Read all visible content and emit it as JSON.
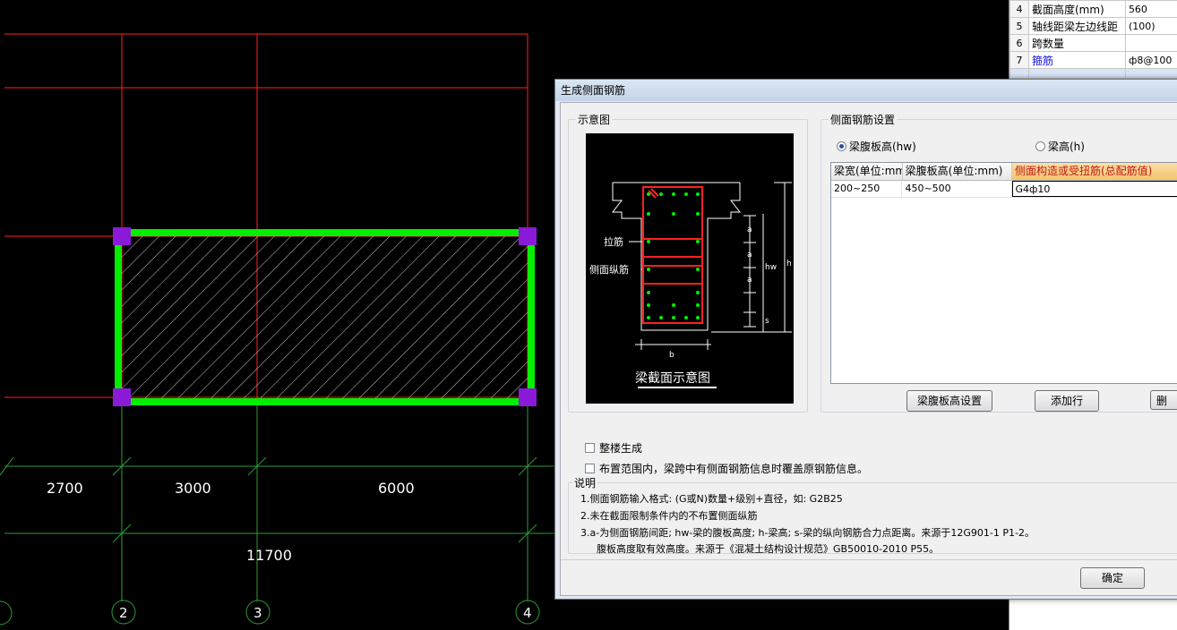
{
  "cad": {
    "dimensions": [
      "2700",
      "3000",
      "6000"
    ],
    "total_dimension": "11700",
    "axis_labels": [
      "2",
      "3",
      "4"
    ]
  },
  "props": {
    "rows": [
      {
        "no": "4",
        "name": "截面高度(mm)",
        "value": "560",
        "link": false
      },
      {
        "no": "5",
        "name": "轴线距梁左边线距",
        "value": "(100)",
        "link": false
      },
      {
        "no": "6",
        "name": "跨数量",
        "value": "",
        "link": false
      },
      {
        "no": "7",
        "name": "箍筋",
        "value": "ф8@100",
        "link": true
      }
    ]
  },
  "dialog": {
    "title": "生成侧面钢筋",
    "schematic_group_label": "示意图",
    "schematic": {
      "label_tie": "拉筋",
      "label_side": "侧面纵筋",
      "caption": "梁截面示意图",
      "dim_a": "a",
      "dim_hw": "hw",
      "dim_h": "h",
      "dim_s": "s",
      "dim_b": "b"
    },
    "settings_group_label": "侧面钢筋设置",
    "radio_web_height": "梁腹板高(hw)",
    "radio_beam_height": "梁高(h)",
    "grid": {
      "headers": [
        "梁宽(单位:mm)",
        "梁腹板高(单位:mm)",
        "侧面构造或受扭筋(总配筋值)"
      ],
      "rows": [
        [
          "200~250",
          "450~500",
          "G4ф10"
        ]
      ]
    },
    "buttons": {
      "web_height_settings": "梁腹板高设置",
      "add_row": "添加行",
      "delete": "删",
      "ok": "确定"
    },
    "check_whole_floor": "整楼生成",
    "check_overwrite": "布置范围内，梁跨中有侧面钢筋信息时覆盖原钢筋信息。",
    "notes_title": "说明",
    "notes": [
      "1.侧面钢筋输入格式: (G或N)数量+级别+直径，如: G2B25",
      "2.未在截面限制条件内的不布置侧面纵筋",
      "3.a-为侧面钢筋间距; hw-梁的腹板高度; h-梁高; s-梁的纵向钢筋合力点距离。来源于12G901-1 P1-2。",
      "腹板高度取有效高度。来源于《混凝土结构设计规范》GB50010-2010 P55。"
    ]
  },
  "colors": {
    "grid_red": "#ff2020",
    "axis_green": "#2e9a3a",
    "beam_green": "#00ee00",
    "corner_purple": "#8a1ad8",
    "highlight_ellipse": "#e02020"
  }
}
